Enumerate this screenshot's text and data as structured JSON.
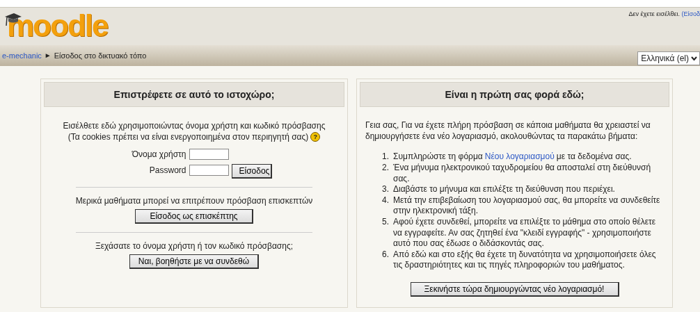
{
  "header": {
    "logo": "moodle",
    "login_info": {
      "text": "Δεν έχετε εισέλθει.",
      "link": "(Είσοδ"
    }
  },
  "breadcrumb": {
    "items": [
      "e-mechanic",
      "Είσοδος στο δικτυακό τόπο"
    ],
    "separator": "►"
  },
  "language": {
    "value": "Ελληνικά (el)"
  },
  "login_box": {
    "title": "Επιστρέφετε σε αυτό το ιστοχώρο;",
    "intro": [
      "Εισέλθετε εδώ χρησιμοποιώντας όνομα χρήστη και κωδικό πρόσβασης",
      "(Τα cookies πρέπει να είναι ενεργοποιημένα στον περιηγητή σας)"
    ],
    "help": "?",
    "username_label": "Όνομα χρήστη",
    "password_label": "Password",
    "login_button": "Είσοδος",
    "guest_text": "Μερικά μαθήματα μπορεί να επιτρέπουν πρόσβαση επισκεπτών",
    "guest_button": "Είσοδος ως επισκέπτης",
    "forgot_text": "Ξεχάσατε το όνομα χρήστη ή τον κωδικό πρόσβασης;",
    "forgot_button": "Ναι, βοηθήστε με να συνδεθώ"
  },
  "signup_box": {
    "title": "Είναι η πρώτη σας φορά εδώ;",
    "intro": "Γεια σας, Για να έχετε πλήρη πρόσβαση σε κάποια μαθήματα θα χρειαστεί να δημιουργήσετε ένα νέο λογαριασμό, ακολουθώντας τα παρακάτω βήματα:",
    "steps": [
      {
        "number": "1.",
        "text": "Συμπληρώστε τη φόρμα",
        "link": "Νέου λογαριασμού",
        "after": "με τα δεδομένα σας."
      },
      {
        "number": "2.",
        "text": "Ένα μήνυμα ηλεκτρονικού ταχυδρομείου θα αποσταλεί στη διεύθυνσή σας."
      },
      {
        "number": "3.",
        "text": "Διαβάστε το μήνυμα και επιλέξτε τη διεύθυνση που περιέχει."
      },
      {
        "number": "4.",
        "text": "Μετά την επιβεβαίωση του λογαριασμού σας, θα μπορείτε να συνδεθείτε στην ηλεκτρονική τάξη."
      },
      {
        "number": "5.",
        "text": "Αφού έχετε συνδεθεί, μπορείτε να επιλέξτε το μάθημα στο οποίο θέλετε να εγγραφείτε. Αν σας ζητηθεί ένα \"κλειδί εγγραφής\" - χρησιμοποιήστε αυτό που σας έδωσε ο διδάσκοντάς σας."
      },
      {
        "number": "6.",
        "text": "Από εδώ και στο εξής θα έχετε τη δυνατότητα να χρησιμοποιήσετε όλες τις δραστηριότητες και τις πηγές πληροφοριών του μαθήματος."
      }
    ],
    "signup_button": "Ξεκινήστε τώρα δημιουργώντας νέο λογαριασμό!"
  }
}
